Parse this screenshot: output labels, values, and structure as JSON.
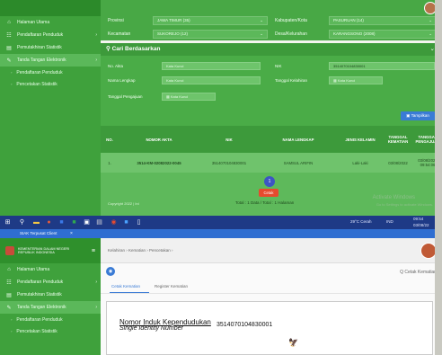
{
  "top": {
    "sidebar": {
      "items": [
        {
          "icon": "⌂",
          "label": "Halaman Utama"
        },
        {
          "icon": "☷",
          "label": "Pendaftaran Penduduk",
          "chevron": "›"
        },
        {
          "icon": "▤",
          "label": "Pemutakhiran Statistik"
        },
        {
          "icon": "✎",
          "label": "Tanda Tangan Elektronik",
          "chevron": "›"
        }
      ],
      "subitems": [
        "Pendaftaran Penduduk",
        "Pencetakan Statistik"
      ]
    },
    "filters": {
      "provinsi_label": "Provinsi",
      "provinsi_value": "JAWA TIMUR (35)",
      "kabupaten_label": "Kabupaten/Kota",
      "kabupaten_value": "PASURUAN (14)",
      "kecamatan_label": "Kecamatan",
      "kecamatan_value": "SUKOREJO (12)",
      "desa_label": "Desa/Kelurahan",
      "desa_value": "KARANGSONO (2008)",
      "arrow": "⌄"
    },
    "search": {
      "title": "Cari Berdasarkan",
      "chevron": "⌄",
      "no_akta_label": "No. Akta",
      "no_akta_placeholder": "Kata Kunci",
      "nik_label": "NIK",
      "nik_value": "3514070104830001",
      "nama_label": "Nama Lengkap",
      "nama_placeholder": "Kata Kunci",
      "tanggal_lahir_label": "Tanggal Kelahiran",
      "tanggal_lahir_placeholder": "Kata Kunci",
      "tanggal_pengajuan_label": "Tanggal Pengajuan",
      "tanggal_pengajuan_placeholder": "Kata Kunci",
      "button": "Tampilkan"
    },
    "table": {
      "headers": [
        "NO.",
        "NOMOR AKTA",
        "NIK",
        "NAMA LENGKAP",
        "JENIS KELAMIN",
        "TANGGAL KEMATIAN",
        "TANGGAL PENGAJUAN"
      ],
      "rows": [
        [
          "1.",
          "3514-KM-02082022-0045",
          "3514070104830001",
          "SAMSUL ARIFIN",
          "Laki-Laki",
          "03/08/2022",
          "03/08/2022 09:54:06"
        ]
      ]
    },
    "footer": {
      "page": "1",
      "cetak": "Cetak",
      "left_text": "Copyright 2022 | Ini",
      "total": "Total : 1 Data / Total : 1 Halaman",
      "activate": "Activate Windows",
      "activate_sub": "Go to Settings to activate Windows."
    }
  },
  "taskbar": {
    "weather": "29°C Cerah",
    "lang": "IND",
    "time": "09:54",
    "date": "03/08/22"
  },
  "bottom": {
    "tab_title": "SIAK Terpusat Client",
    "tab_close": "×",
    "brand_line1": "KEMENTERIAN DALAM NEGERI",
    "brand_line2": "REPUBLIK INDONESIA",
    "menu_icon": "≡",
    "sidebar": {
      "items": [
        {
          "icon": "⌂",
          "label": "Halaman Utama"
        },
        {
          "icon": "☷",
          "label": "Pendaftaran Penduduk",
          "chevron": "›"
        },
        {
          "icon": "▤",
          "label": "Pemutakhiran Statistik"
        },
        {
          "icon": "✎",
          "label": "Tanda Tangan Elektronik",
          "chevron": "›"
        }
      ],
      "subitems": [
        "Pendaftaran Penduduk",
        "Pencetakan Statistik"
      ]
    },
    "breadcrumb": "Kelahiran  ›  Kematian  ›  Pencetakan  ›",
    "cetak_link": "Q  Cetak Kematian",
    "subtabs": [
      "Cetak Kematian",
      "Register Kematian"
    ],
    "card": {
      "title": "Nomor Induk Kependudukan",
      "subtitle": "Single Identity Number",
      "value": "3514070104830001",
      "emblem": "🦅"
    }
  }
}
